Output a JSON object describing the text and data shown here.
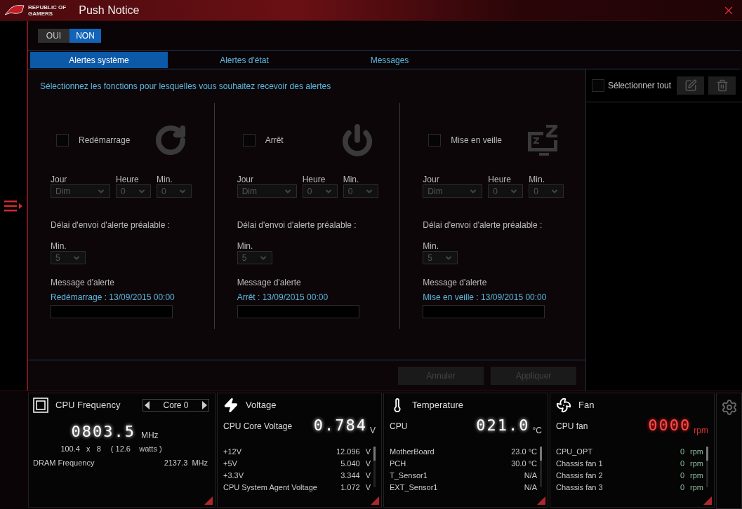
{
  "window": {
    "title": "Push Notice",
    "logo_lines": [
      "REPUBLIC OF",
      "GAMERS"
    ]
  },
  "toggle": [
    {
      "label": "OUI",
      "selected": false
    },
    {
      "label": "NON",
      "selected": true
    }
  ],
  "tabs": [
    {
      "label": "Alertes système",
      "selected": true
    },
    {
      "label": "Alertes d'état",
      "selected": false
    },
    {
      "label": "Messages",
      "selected": false
    }
  ],
  "instruction": "Sélectionnez les fonctions pour lesquelles vous souhaitez recevoir des alertes",
  "alerts": [
    {
      "kind": "restart",
      "label": "Redémarrage",
      "checked": false,
      "day_label": "Jour",
      "day_value": "Dim",
      "hour_label": "Heure",
      "hour_value": "0",
      "min_label": "Min.",
      "min_value": "0",
      "delay_label": "Délai d'envoi d'alerte préalable :",
      "delay_min_label": "Min.",
      "delay_value": "5",
      "message_label": "Message d'alerte",
      "message": "Redémarrage : 13/09/2015 00:00"
    },
    {
      "kind": "shutdown",
      "label": "Arrêt",
      "checked": false,
      "day_label": "Jour",
      "day_value": "Dim",
      "hour_label": "Heure",
      "hour_value": "0",
      "min_label": "Min.",
      "min_value": "0",
      "delay_label": "Délai d'envoi d'alerte préalable :",
      "delay_min_label": "Min.",
      "delay_value": "5",
      "message_label": "Message d'alerte",
      "message": "Arrêt : 13/09/2015 00:00"
    },
    {
      "kind": "sleep",
      "label": "Mise en veille",
      "checked": false,
      "day_label": "Jour",
      "day_value": "Dim",
      "hour_label": "Heure",
      "hour_value": "0",
      "min_label": "Min.",
      "min_value": "0",
      "delay_label": "Délai d'envoi d'alerte préalable :",
      "delay_min_label": "Min.",
      "delay_value": "5",
      "message_label": "Message d'alerte",
      "message": "Mise en veille : 13/09/2015 00:00"
    }
  ],
  "select_all": {
    "label": "Sélectionner tout",
    "checked": false
  },
  "buttons": [
    {
      "label": "Annuler",
      "disabled": true
    },
    {
      "label": "Appliquer",
      "disabled": true
    }
  ],
  "monitor": {
    "cpu_frequency": {
      "title": "CPU Frequency",
      "core": "Core 0",
      "value": "0803.5",
      "unit": "MHz",
      "ratio": "100.4   x   8",
      "power": "( 12.6    watts )",
      "dram_label": "DRAM Frequency",
      "dram_value": "2137.3  MHz"
    },
    "voltage": {
      "title": "Voltage",
      "main_label": "CPU Core Voltage",
      "value": "0.784",
      "unit": "V",
      "rows": [
        {
          "label": "+12V",
          "value": "12.096",
          "unit": "V"
        },
        {
          "label": "+5V",
          "value": "5.040",
          "unit": "V"
        },
        {
          "label": "+3.3V",
          "value": "3.344",
          "unit": "V"
        },
        {
          "label": "CPU System Agent Voltage",
          "value": "1.072",
          "unit": "V"
        }
      ]
    },
    "temperature": {
      "title": "Temperature",
      "main_label": "CPU",
      "value": "021.0",
      "unit": "°C",
      "rows": [
        {
          "label": "MotherBoard",
          "value": "23.0 °C"
        },
        {
          "label": "PCH",
          "value": "30.0 °C"
        },
        {
          "label": "T_Sensor1",
          "value": "N/A"
        },
        {
          "label": "EXT_Sensor1",
          "value": "N/A"
        }
      ]
    },
    "fan": {
      "title": "Fan",
      "main_label": "CPU fan",
      "value": "0000",
      "unit": "rpm",
      "rows": [
        {
          "label": "CPU_OPT",
          "value": "0",
          "unit": "rpm"
        },
        {
          "label": "Chassis fan 1",
          "value": "0",
          "unit": "rpm"
        },
        {
          "label": "Chassis fan 2",
          "value": "0",
          "unit": "rpm"
        },
        {
          "label": "Chassis fan 3",
          "value": "0",
          "unit": "rpm"
        }
      ]
    }
  }
}
